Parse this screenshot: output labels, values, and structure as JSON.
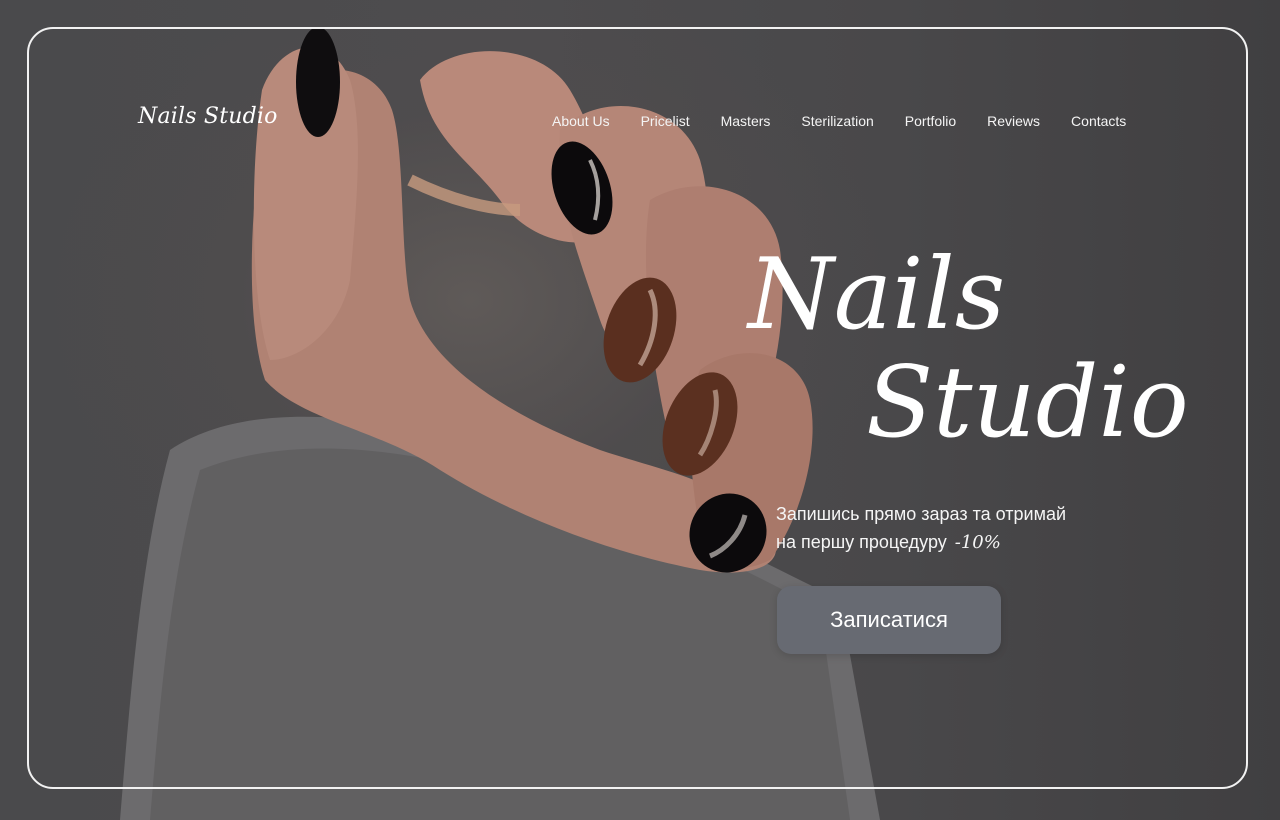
{
  "header": {
    "logo_text": "Nails Studio",
    "nav": [
      {
        "label": "About Us"
      },
      {
        "label": "Pricelist"
      },
      {
        "label": "Masters"
      },
      {
        "label": "Sterilization"
      },
      {
        "label": "Portfolio"
      },
      {
        "label": "Reviews"
      },
      {
        "label": "Contacts"
      }
    ]
  },
  "hero": {
    "title_line1": "Nails",
    "title_line2": "Studio",
    "promo_line1": "Запишись прямо зараз та отримай",
    "promo_line2": "на першу процедуру",
    "discount": "-10%",
    "cta_label": "Записатися"
  },
  "colors": {
    "text": "#ffffff",
    "frame_border": "#f2f2f2",
    "cta_bg": "#676a72"
  },
  "icons": {
    "background": "hand-with-manicure-photo"
  }
}
